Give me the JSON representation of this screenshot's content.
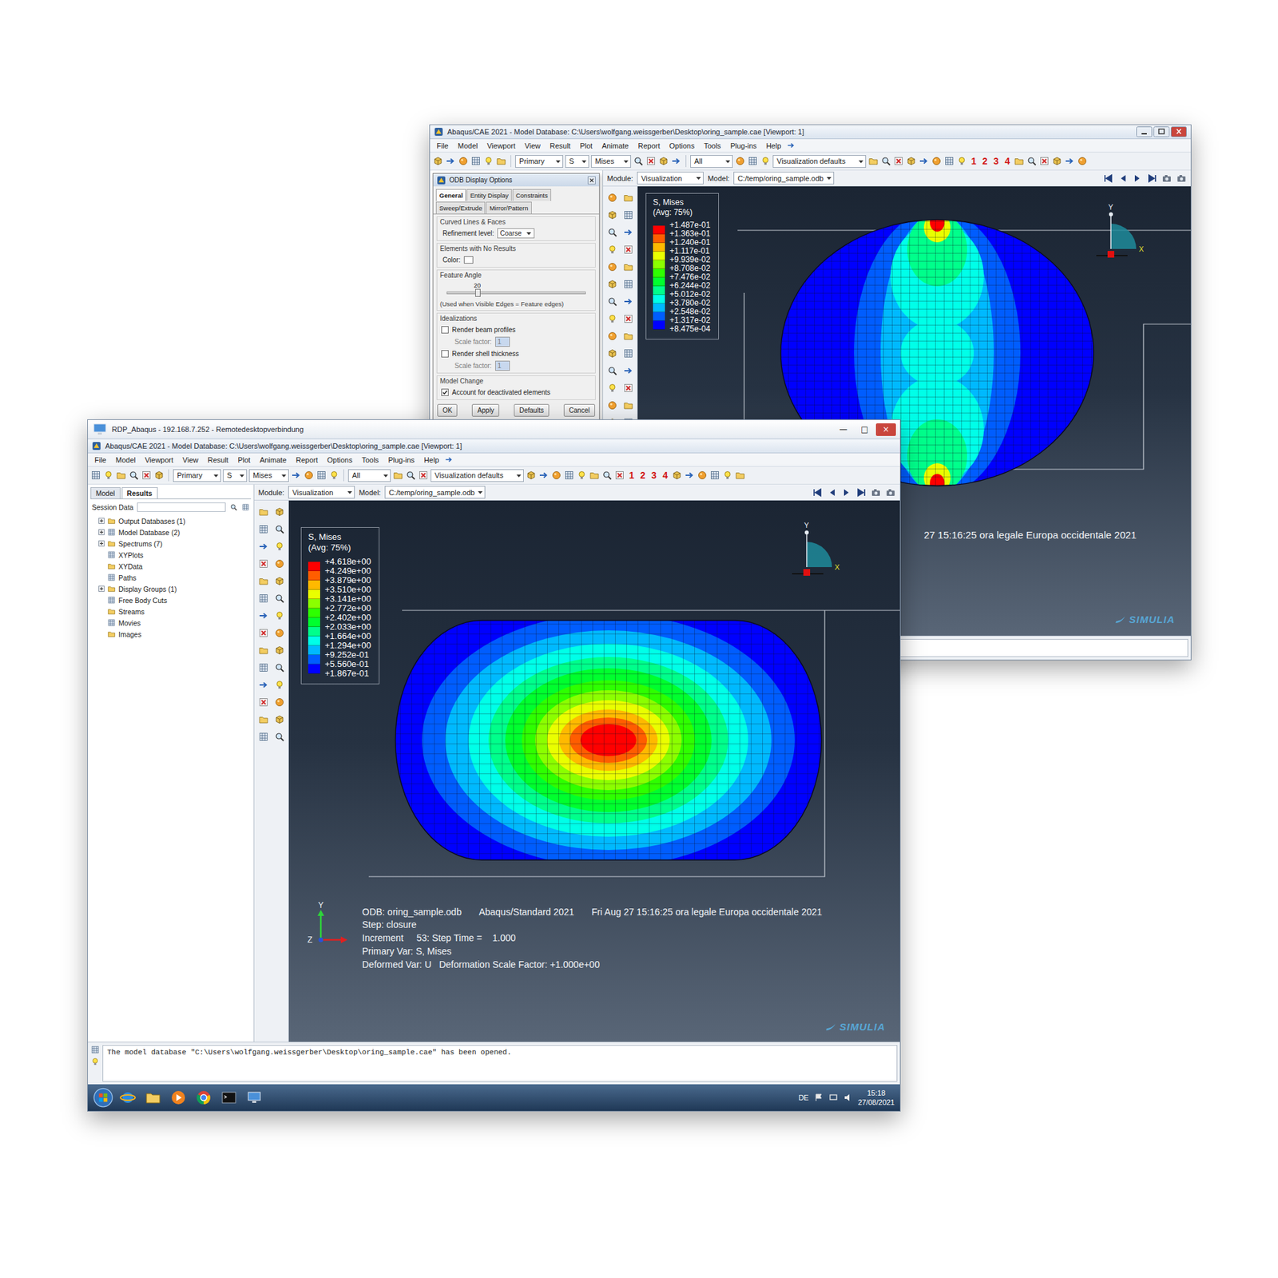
{
  "back_window": {
    "title": "Abaqus/CAE 2021 - Model Database: C:\\Users\\wolfgang.weissgerber\\Desktop\\oring_sample.cae [Viewport: 1]",
    "menu": [
      "File",
      "Model",
      "Viewport",
      "View",
      "Result",
      "Plot",
      "Animate",
      "Report",
      "Options",
      "Tools",
      "Plug-ins",
      "Help"
    ],
    "toolbar": {
      "primary": "Primary",
      "component": "S",
      "invariant": "Mises",
      "display_group": "All",
      "view_preset": "Visualization defaults",
      "views": [
        "1",
        "2",
        "3",
        "4"
      ]
    },
    "context": {
      "module_label": "Module:",
      "module": "Visualization",
      "model_label": "Model:",
      "model": "C:/temp/oring_sample.odb"
    },
    "dialog": {
      "title": "ODB Display Options",
      "tabs": [
        {
          "label": "General",
          "selected": true
        },
        {
          "label": "Entity Display",
          "selected": false
        },
        {
          "label": "Constraints",
          "selected": false
        },
        {
          "label": "Sweep/Extrude",
          "selected": false
        },
        {
          "label": "Mirror/Pattern",
          "selected": false
        }
      ],
      "curved": {
        "heading": "Curved Lines & Faces",
        "label": "Refinement level:",
        "value": "Coarse"
      },
      "no_results": {
        "heading": "Elements with No Results",
        "label": "Color:"
      },
      "feature_angle": {
        "heading": "Feature Angle",
        "value": "20",
        "level": 0.22,
        "note": "(Used when Visible Edges = Feature edges)"
      },
      "idealizations": {
        "heading": "Idealizations",
        "options": [
          {
            "label": "Render beam profiles",
            "checked": false,
            "scale_label": "Scale factor:",
            "scale": "1",
            "scale_disabled": true
          },
          {
            "label": "Render shell thickness",
            "checked": false,
            "scale_label": "Scale factor:",
            "scale": "1",
            "scale_disabled": true
          }
        ]
      },
      "model_change": {
        "heading": "Model Change",
        "label": "Account for deactivated elements",
        "checked": true
      },
      "buttons": [
        "OK",
        "Apply",
        "Defaults",
        "Cancel"
      ]
    },
    "legend": {
      "title": "S, Mises",
      "subtitle": "(Avg: 75%)",
      "values": [
        "+1.487e-01",
        "+1.363e-01",
        "+1.240e-01",
        "+1.117e-01",
        "+9.939e-02",
        "+8.708e-02",
        "+7.476e-02",
        "+6.244e-02",
        "+5.012e-02",
        "+3.780e-02",
        "+2.548e-02",
        "+1.317e-02",
        "+8.475e-04"
      ],
      "spectrum": [
        "#ff0000",
        "#ff5d00",
        "#ffb900",
        "#e9ff00",
        "#8bff00",
        "#2eff00",
        "#00ff2e",
        "#00ff8b",
        "#00ffe8",
        "#00b9ff",
        "#005dff",
        "#0000ff"
      ]
    },
    "info_fragment": "27 15:16:25 ora legale Europa occidentale 2021",
    "triad": {
      "up": "Y",
      "right": "X"
    },
    "brand": "SIMULIA"
  },
  "front_window": {
    "rdp_title": "RDP_Abaqus - 192.168.7.252 - Remotedesktopverbindung",
    "window_controls": [
      "—",
      "□",
      "×"
    ],
    "title": "Abaqus/CAE 2021 - Model Database: C:\\Users\\wolfgang.weissgerber\\Desktop\\oring_sample.cae [Viewport: 1]",
    "menu": [
      "File",
      "Model",
      "Viewport",
      "View",
      "Result",
      "Plot",
      "Animate",
      "Report",
      "Options",
      "Tools",
      "Plug-ins",
      "Help"
    ],
    "toolbar": {
      "primary": "Primary",
      "component": "S",
      "invariant": "Mises",
      "display_group": "All",
      "view_preset": "Visualization defaults",
      "views": [
        "1",
        "2",
        "3",
        "4"
      ]
    },
    "tabs": [
      {
        "label": "Model",
        "selected": false
      },
      {
        "label": "Results",
        "selected": true
      }
    ],
    "session_title": "Session Data",
    "tree": [
      {
        "label": "Output Databases (1)",
        "expandable": true
      },
      {
        "label": "Model Database (2)",
        "expandable": true
      },
      {
        "label": "Spectrums (7)",
        "expandable": true
      },
      {
        "label": "XYPlots",
        "expandable": false
      },
      {
        "label": "XYData",
        "expandable": false
      },
      {
        "label": "Paths",
        "expandable": false
      },
      {
        "label": "Display Groups (1)",
        "expandable": true
      },
      {
        "label": "Free Body Cuts",
        "expandable": false
      },
      {
        "label": "Streams",
        "expandable": false
      },
      {
        "label": "Movies",
        "expandable": false
      },
      {
        "label": "Images",
        "expandable": false
      }
    ],
    "context": {
      "module_label": "Module:",
      "module": "Visualization",
      "model_label": "Model:",
      "model": "C:/temp/oring_sample.odb"
    },
    "legend": {
      "title": "S, Mises",
      "subtitle": "(Avg: 75%)",
      "values": [
        "+4.618e+00",
        "+4.249e+00",
        "+3.879e+00",
        "+3.510e+00",
        "+3.141e+00",
        "+2.772e+00",
        "+2.402e+00",
        "+2.033e+00",
        "+1.664e+00",
        "+1.294e+00",
        "+9.252e-01",
        "+5.560e-01",
        "+1.867e-01"
      ],
      "spectrum": [
        "#ff0000",
        "#ff5d00",
        "#ffb900",
        "#e9ff00",
        "#8bff00",
        "#2eff00",
        "#00ff2e",
        "#00ff8b",
        "#00ffe8",
        "#00b9ff",
        "#005dff",
        "#0000ff"
      ]
    },
    "info": {
      "odb": "ODB: oring_sample.odb",
      "solver": "Abaqus/Standard 2021",
      "date": "Fri Aug 27 15:16:25 ora legale Europa occidentale 2021",
      "lines": [
        "Step: closure",
        "Increment     53: Step Time =    1.000",
        "Primary Var: S, Mises",
        "Deformed Var: U   Deformation Scale Factor: +1.000e+00"
      ]
    },
    "triad": {
      "up": "Y",
      "out": "Z"
    },
    "corner_triad": {
      "up": "Y",
      "right": "X"
    },
    "brand": "SIMULIA",
    "message": "The model database \"C:\\Users\\wolfgang.weissgerber\\Desktop\\oring_sample.cae\" has been opened.",
    "taskbar": {
      "language": "DE",
      "time": "15:18",
      "date": "27/08/2021"
    }
  }
}
